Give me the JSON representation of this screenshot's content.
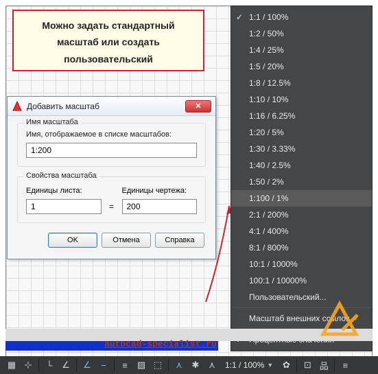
{
  "note": {
    "line1": "Можно задать стандартный",
    "line2": "масштаб или создать",
    "line3": "пользовательский"
  },
  "dialog": {
    "title": "Добавить масштаб",
    "group_name": {
      "legend": "Имя масштаба",
      "label": "Имя, отображаемое в списке масштабов:",
      "value": "1:200"
    },
    "group_props": {
      "legend": "Свойства масштаба",
      "sheet_label": "Единицы листа:",
      "sheet_value": "1",
      "eq": "=",
      "drawing_label": "Единицы чертежа:",
      "drawing_value": "200"
    },
    "buttons": {
      "ok": "OK",
      "cancel": "Отмена",
      "help": "Справка"
    }
  },
  "menu": {
    "items": [
      {
        "label": "1:1 / 100%",
        "checked": true
      },
      {
        "label": "1:2 / 50%"
      },
      {
        "label": "1:4 / 25%"
      },
      {
        "label": "1:5 / 20%"
      },
      {
        "label": "1:8 / 12.5%"
      },
      {
        "label": "1:10 / 10%"
      },
      {
        "label": "1:16 / 6.25%"
      },
      {
        "label": "1:20 / 5%"
      },
      {
        "label": "1:30 / 3.33%"
      },
      {
        "label": "1:40 / 2.5%"
      },
      {
        "label": "1:50 / 2%"
      },
      {
        "label": "1:100 / 1%",
        "selected": true
      },
      {
        "label": "2:1 / 200%"
      },
      {
        "label": "4:1 / 400%"
      },
      {
        "label": "8:1 / 800%"
      },
      {
        "label": "10:1 / 1000%"
      },
      {
        "label": "100:1 / 10000%"
      },
      {
        "label": "Пользовательский..."
      }
    ],
    "xref": "Масштаб внешних ссылок",
    "percent": "Процентные значения"
  },
  "statusbar": {
    "scale": "1:1 / 100%"
  },
  "url": "autocad-specialist.ru"
}
